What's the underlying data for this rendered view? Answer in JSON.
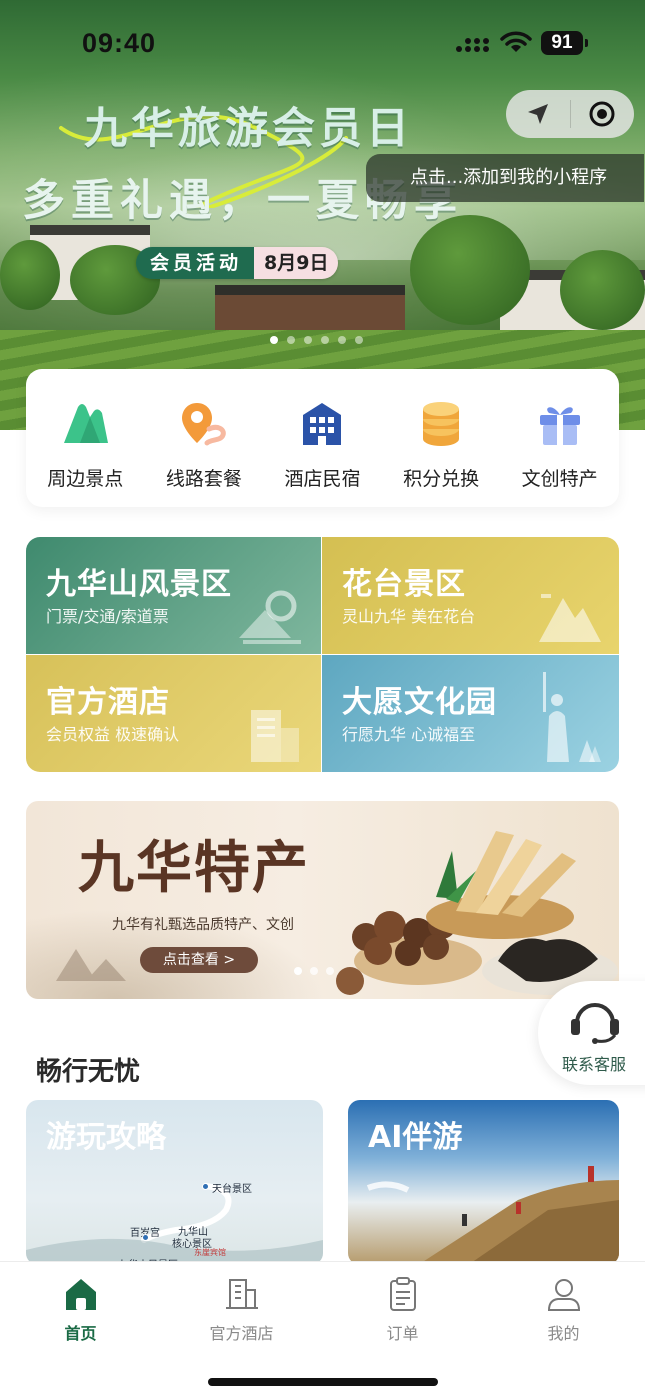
{
  "status_bar": {
    "time": "09:40",
    "battery": "91"
  },
  "hero": {
    "title": "九华旅游会员日",
    "subtitle": "多重礼遇，一夏畅享",
    "badge_label": "会员活动",
    "badge_date": "8月9日",
    "carousel_total": 6,
    "carousel_active": 1
  },
  "mini_program": {
    "tip": "点击...添加到我的小程序"
  },
  "quick_nav": [
    {
      "label": "周边景点",
      "icon": "mountain-icon"
    },
    {
      "label": "线路套餐",
      "icon": "route-pin-icon"
    },
    {
      "label": "酒店民宿",
      "icon": "hotel-icon"
    },
    {
      "label": "积分兑换",
      "icon": "coins-icon"
    },
    {
      "label": "文创特产",
      "icon": "gift-icon"
    }
  ],
  "feature_tiles": [
    {
      "title": "九华山风景区",
      "subtitle": "门票/交通/索道票"
    },
    {
      "title": "花台景区",
      "subtitle": "灵山九华  美在花台"
    },
    {
      "title": "官方酒店",
      "subtitle": "会员权益  极速确认"
    },
    {
      "title": "大愿文化园",
      "subtitle": "行愿九华  心诚福至"
    }
  ],
  "specialty_banner": {
    "title": "九华特产",
    "subtitle": "九华有礼甄选品质特产、文创",
    "button": "点击查看 >",
    "dots_total": 3,
    "dots_active": 1
  },
  "service": {
    "label": "联系客服"
  },
  "section": {
    "title": "畅行无忧",
    "cards": [
      {
        "title": "游玩攻略",
        "map_labels": [
          "天台景区",
          "百岁宫",
          "九华山",
          "核心景区",
          "东崖宾馆",
          "九华山风景区"
        ]
      },
      {
        "title": "AI伴游"
      }
    ]
  },
  "tabbar": [
    {
      "label": "首页",
      "icon": "home-icon",
      "active": true
    },
    {
      "label": "官方酒店",
      "icon": "building-icon",
      "active": false
    },
    {
      "label": "订单",
      "icon": "clipboard-icon",
      "active": false
    },
    {
      "label": "我的",
      "icon": "user-icon",
      "active": false
    }
  ],
  "colors": {
    "brand_green": "#1a6a45",
    "tab_inactive": "#8a8a8a"
  }
}
